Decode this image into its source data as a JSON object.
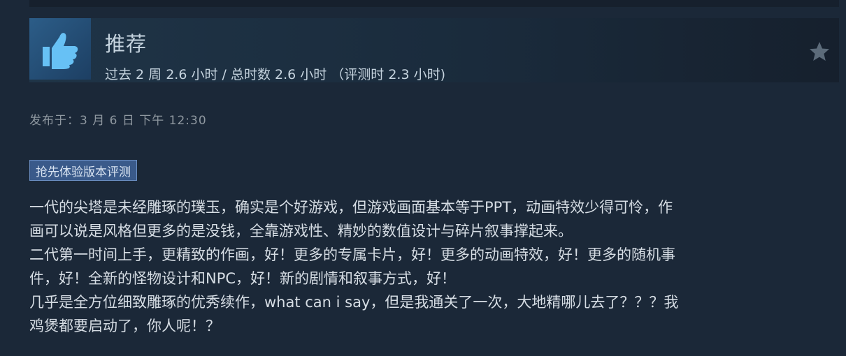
{
  "review": {
    "recommendation": "推荐",
    "hours_text": "过去 2 周 2.6 小时 / 总时数 2.6 小时 （评测时 2.3 小时)",
    "posted": "发布于：3 月 6 日 下午 12:30",
    "badge": "抢先体验版本评测",
    "lines": [
      "一代的尖塔是未经雕琢的璞玉，确实是个好游戏，但游戏画面基本等于PPT，动画特效少得可怜，作",
      "画可以说是风格但更多的是没钱，全靠游戏性、精妙的数值设计与碎片叙事撑起来。",
      "二代第一时间上手，更精致的作画，好！更多的专属卡片，好！更多的动画特效，好！更多的随机事",
      "件，好！全新的怪物设计和NPC，好！新的剧情和叙事方式，好！",
      "几乎是全方位细致雕琢的优秀续作，what can i say，但是我通关了一次，大地精哪儿去了？？？我",
      "鸡煲都要启动了，你人呢！？"
    ]
  },
  "icons": {
    "thumb": "thumbs-up-icon",
    "star": "star-icon"
  },
  "colors": {
    "background": "#1b2838",
    "thumb_box": "#2c5d88",
    "thumb": "#67c1f5",
    "badge_bg": "#3a5a8a",
    "text": "#c6d4df"
  }
}
